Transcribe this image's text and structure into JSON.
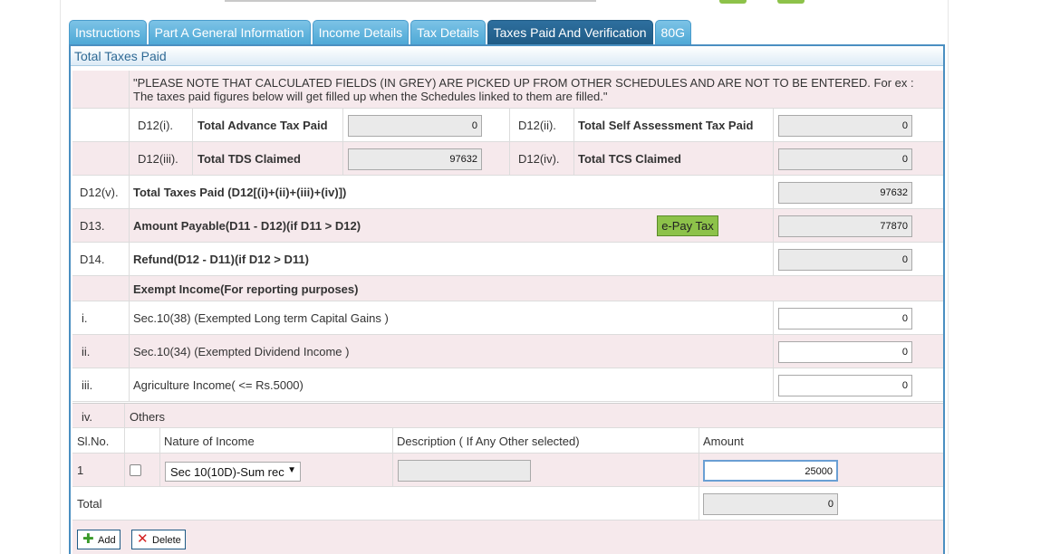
{
  "tabs": [
    "Instructions",
    "Part A General Information",
    "Income Details",
    "Tax Details",
    "Taxes Paid And Verification",
    "80G"
  ],
  "panel_title": "Total Taxes Paid",
  "note": "\"PLEASE NOTE THAT CALCULATED FIELDS (IN GREY) ARE PICKED UP FROM OTHER SCHEDULES AND ARE NOT TO BE ENTERED. For ex : The taxes paid figures below will get filled up when the Schedules linked to them are filled.\"",
  "d12i": {
    "code": "D12(i).",
    "label": "Total Advance Tax Paid",
    "value": "0"
  },
  "d12ii": {
    "code": "D12(ii).",
    "label": "Total Self Assessment Tax Paid",
    "value": "0"
  },
  "d12iii": {
    "code": "D12(iii).",
    "label": "Total TDS Claimed",
    "value": "97632"
  },
  "d12iv": {
    "code": "D12(iv).",
    "label": "Total TCS Claimed",
    "value": "0"
  },
  "d12v": {
    "code": "D12(v).",
    "label": "Total Taxes Paid (D12[(i)+(ii)+(iii)+(iv)])",
    "value": "97632"
  },
  "d13": {
    "code": "D13.",
    "label": "Amount Payable(D11 - D12)(if D11 > D12)",
    "value": "77870",
    "epay": "e-Pay Tax"
  },
  "d14": {
    "code": "D14.",
    "label": "Refund(D12 - D11)(if D12 > D11)",
    "value": "0"
  },
  "exempt_heading": "Exempt Income(For reporting purposes)",
  "exempt": [
    {
      "code": "i.",
      "label": "Sec.10(38) (Exempted Long term Capital Gains )",
      "value": "0"
    },
    {
      "code": "ii.",
      "label": "Sec.10(34) (Exempted Dividend Income )",
      "value": "0"
    },
    {
      "code": "iii.",
      "label": "Agriculture Income( <= Rs.5000)",
      "value": "0"
    }
  ],
  "others": {
    "code": "iv.",
    "label": "Others"
  },
  "table": {
    "headers": [
      "Sl.No.",
      "",
      "Nature of Income",
      "Description ( If Any Other selected)",
      "Amount"
    ],
    "row": {
      "sl": "1",
      "nature": "Sec 10(10D)-Sum rec",
      "description": "",
      "amount": "25000"
    },
    "total_label": "Total",
    "total_value": "0"
  },
  "buttons": {
    "add": "Add",
    "delete": "Delete"
  },
  "colors": {
    "tab": "#5aaedb",
    "tab_active": "#1f5b86",
    "row_pink": "#f6e9ec",
    "epay": "#8dc24a"
  }
}
